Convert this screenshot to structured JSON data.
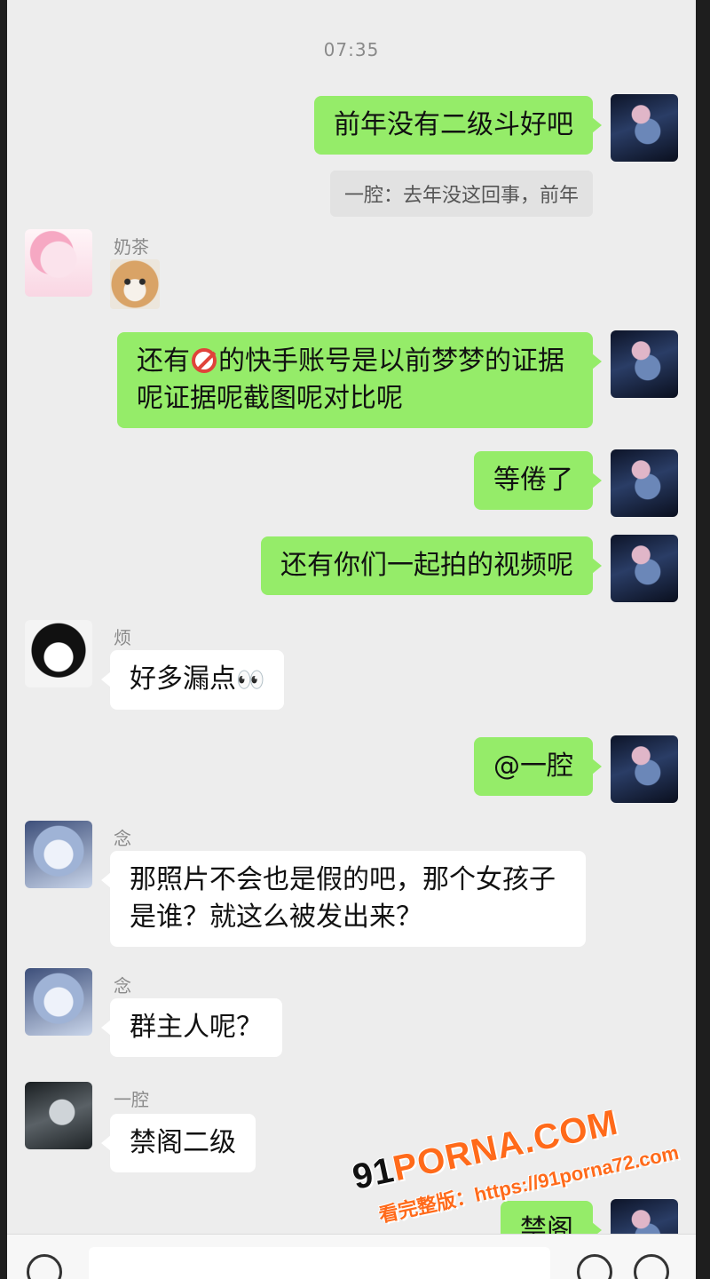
{
  "chat": {
    "timestamp": "07:35",
    "messages": [
      {
        "sender": "",
        "text": "前年没有二级斗好吧"
      },
      {
        "quote": "一腔：去年没这回事，前年"
      },
      {
        "sender": "奶茶",
        "sticker": "cat-sticker"
      },
      {
        "sender": "",
        "text_before": "还有",
        "text_after": "的快手账号是以前梦梦的证据呢证据呢截图呢对比呢"
      },
      {
        "sender": "",
        "text": "等倦了"
      },
      {
        "sender": "",
        "text": "还有你们一起拍的视频呢"
      },
      {
        "sender": "烦",
        "text": "好多漏点",
        "emoji": "👀"
      },
      {
        "sender": "",
        "text": "@一腔"
      },
      {
        "sender": "念",
        "text": "那照片不会也是假的吧，那个女孩子是谁？就这么被发出来？"
      },
      {
        "sender": "念",
        "text": "群主人呢？"
      },
      {
        "sender": "一腔",
        "text": "禁阁二级"
      },
      {
        "sender": "",
        "text": "禁阁"
      }
    ]
  },
  "watermark": {
    "logo_prefix": "91",
    "logo_main": "PORNA.COM",
    "caption": "看完整版：https://91porna72.com"
  },
  "colors": {
    "self_bubble": "#95ec69",
    "other_bubble": "#ffffff",
    "background": "#ededed"
  }
}
